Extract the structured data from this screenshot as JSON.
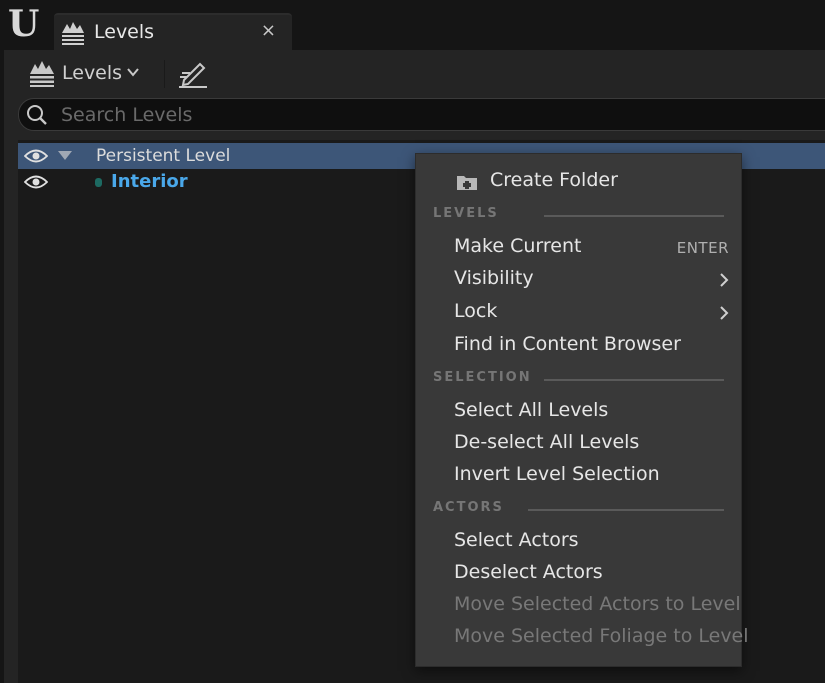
{
  "tab": {
    "title": "Levels",
    "close": "×"
  },
  "toolbar": {
    "levels_label": "Levels"
  },
  "search": {
    "placeholder": "Search Levels",
    "value": ""
  },
  "tree": {
    "rows": [
      {
        "label": "Persistent Level",
        "selected": true
      },
      {
        "label": "Interior",
        "current": true
      }
    ]
  },
  "menu": {
    "create_folder": "Create Folder",
    "sections": {
      "levels": "LEVELS",
      "selection": "SELECTION",
      "actors": "ACTORS"
    },
    "items": {
      "make_current": "Make Current",
      "make_current_shortcut": "ENTER",
      "visibility": "Visibility",
      "lock": "Lock",
      "find_in_cb": "Find in Content Browser",
      "select_all": "Select All Levels",
      "deselect_all": "De-select All Levels",
      "invert": "Invert Level Selection",
      "select_actors": "Select Actors",
      "deselect_actors": "Deselect Actors",
      "move_actors": "Move Selected Actors to Level",
      "move_foliage": "Move Selected Foliage to Level"
    }
  },
  "colors": {
    "selection": "#3d5678",
    "current_level": "#4aa8ea",
    "menu_bg": "#393939"
  }
}
